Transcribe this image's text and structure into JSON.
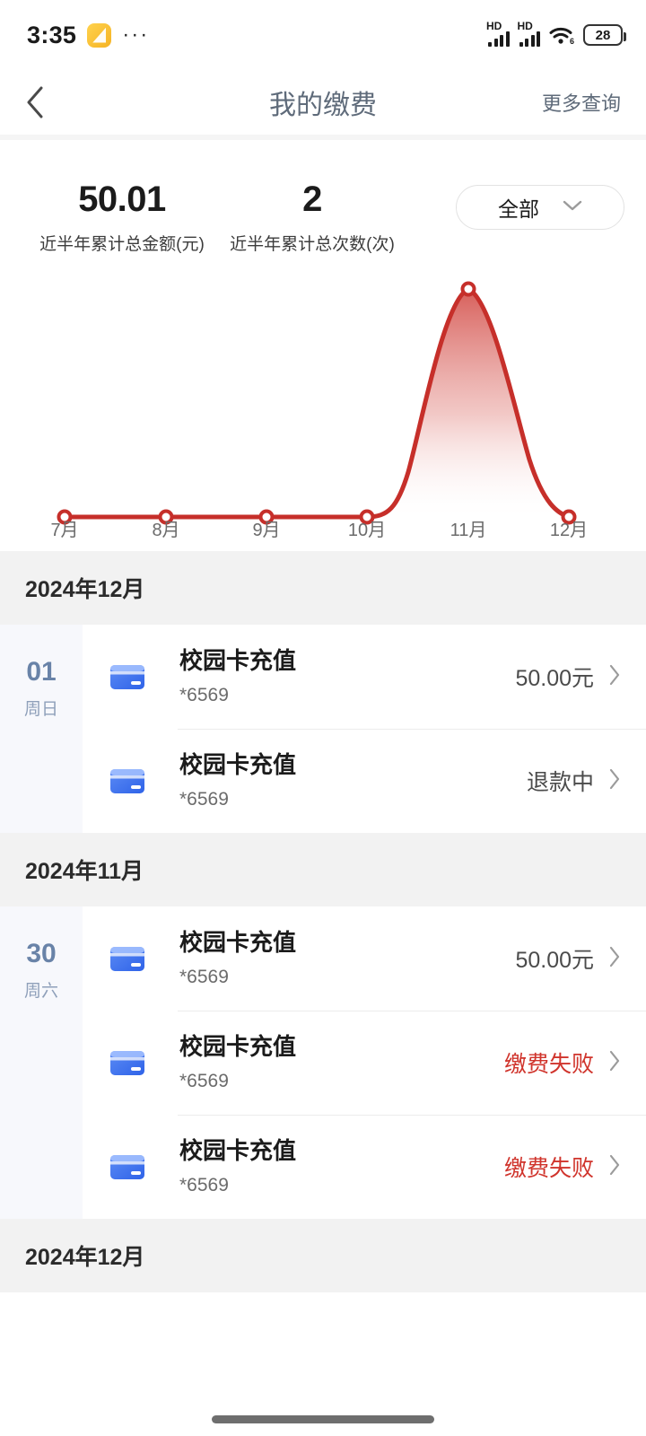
{
  "status_bar": {
    "time": "3:35",
    "app_icon": "note-app-icon",
    "overflow": "···",
    "hd_label_1": "HD",
    "hd_label_2": "HD",
    "wifi_icon": "wifi-6-icon",
    "battery_level": "28"
  },
  "nav": {
    "back_icon": "chevron-left-icon",
    "title": "我的缴费",
    "more_label": "更多查询"
  },
  "summary": {
    "amount_value": "50.01",
    "amount_label": "近半年累计总金额(元)",
    "count_value": "2",
    "count_label": "近半年累计总次数(次)",
    "filter_label": "全部",
    "filter_icon": "chevron-down-icon"
  },
  "chart_data": {
    "type": "area",
    "title": "",
    "xlabel": "",
    "ylabel": "",
    "categories": [
      "7月",
      "8月",
      "9月",
      "10月",
      "11月",
      "12月"
    ],
    "values": [
      0,
      0,
      0,
      0,
      50.01,
      0
    ],
    "ylim": [
      0,
      50.01
    ],
    "grid": false,
    "legend": "none",
    "line_color": "#c62f2a",
    "fill_gradient_top": "#d4514c",
    "fill_gradient_bottom": "#ffffff",
    "marker": "open-circle"
  },
  "sections": [
    {
      "header": "2024年12月",
      "days": [
        {
          "day": "01",
          "weekday": "周日",
          "rows": [
            {
              "icon": "bank-card-icon",
              "title": "校园卡充值",
              "sub": "*6569",
              "right": "50.00元",
              "right_state": "normal",
              "chevron": "chevron-right-icon"
            },
            {
              "icon": "bank-card-icon",
              "title": "校园卡充值",
              "sub": "*6569",
              "right": "退款中",
              "right_state": "pending",
              "chevron": "chevron-right-icon"
            }
          ]
        }
      ]
    },
    {
      "header": "2024年11月",
      "days": [
        {
          "day": "30",
          "weekday": "周六",
          "rows": [
            {
              "icon": "bank-card-icon",
              "title": "校园卡充值",
              "sub": "*6569",
              "right": "50.00元",
              "right_state": "normal",
              "chevron": "chevron-right-icon"
            },
            {
              "icon": "bank-card-icon",
              "title": "校园卡充值",
              "sub": "*6569",
              "right": "缴费失败",
              "right_state": "failed",
              "chevron": "chevron-right-icon"
            },
            {
              "icon": "bank-card-icon",
              "title": "校园卡充值",
              "sub": "*6569",
              "right": "缴费失败",
              "right_state": "failed",
              "chevron": "chevron-right-icon"
            }
          ]
        }
      ]
    },
    {
      "header": "2024年12月",
      "days": []
    }
  ],
  "colors": {
    "chart_red": "#c62f2a",
    "failed_red": "#d0342c",
    "title_slate": "#5f6b7a",
    "day_blue": "#6983a8",
    "section_bg": "#f2f2f2"
  }
}
